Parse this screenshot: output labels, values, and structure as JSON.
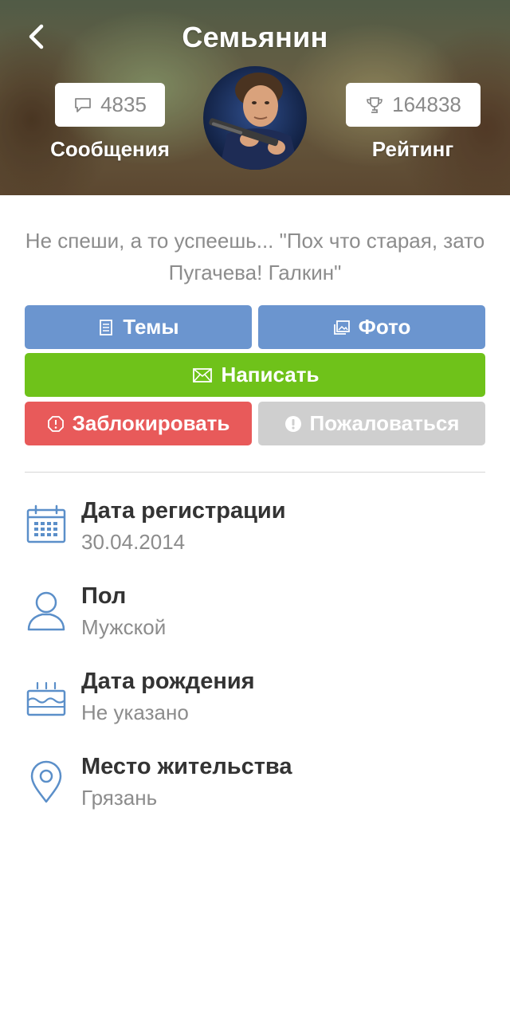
{
  "header": {
    "title": "Семьянин",
    "messages_count": "4835",
    "messages_label": "Сообщения",
    "rating_count": "164838",
    "rating_label": "Рейтинг"
  },
  "status_text": "Не спеши, а то успеешь...    \"Пох что старая, зато Пугачева! Галкин\"",
  "buttons": {
    "topics": "Темы",
    "photo": "Фото",
    "write": "Написать",
    "block": "Заблокировать",
    "report": "Пожаловаться"
  },
  "info": [
    {
      "label": "Дата регистрации",
      "value": "30.04.2014",
      "icon": "calendar-icon"
    },
    {
      "label": "Пол",
      "value": "Мужской",
      "icon": "person-icon"
    },
    {
      "label": "Дата рождения",
      "value": "Не указано",
      "icon": "birthday-cake-icon"
    },
    {
      "label": "Место жительства",
      "value": "Грязань",
      "icon": "location-pin-icon"
    }
  ],
  "colors": {
    "primary_blue": "#6b95cf",
    "write_green": "#6fc21a",
    "block_red": "#e85a5a",
    "report_gray": "#cfcfcf",
    "icon_blue": "#5b8fc9"
  }
}
